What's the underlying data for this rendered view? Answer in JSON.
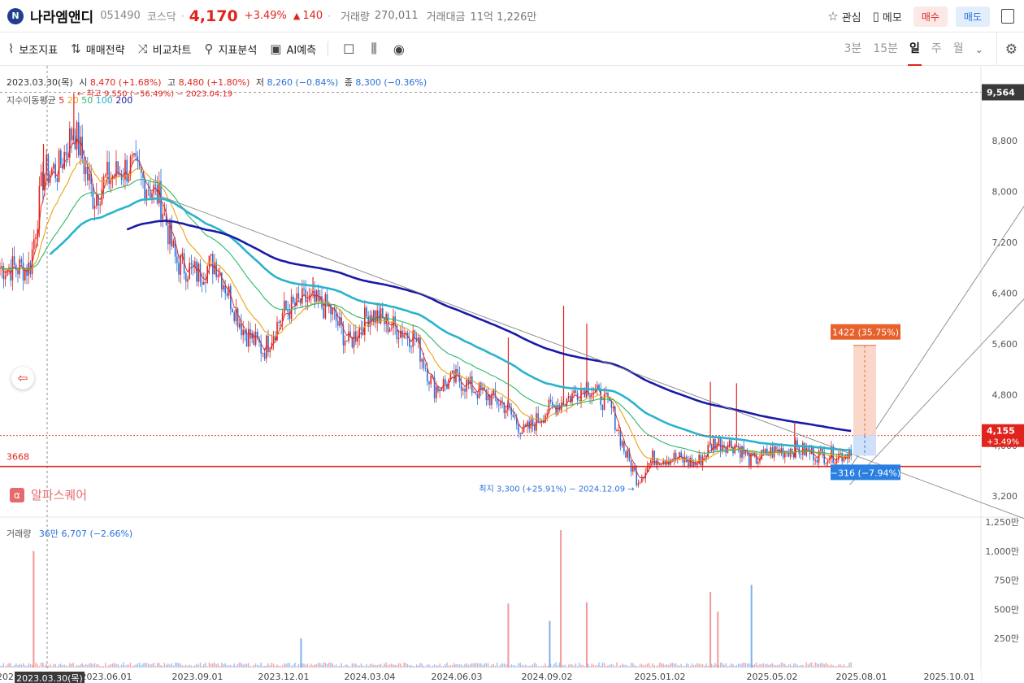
{
  "header": {
    "logo_text": "N",
    "name": "나라엠앤디",
    "code": "051490",
    "market": "코스닥",
    "dot": "·",
    "price": "4,170",
    "change_pct": "+3.49%",
    "change_arrow": "▲",
    "change_abs": "140",
    "volume_label": "거래량",
    "volume_value": "270,011",
    "amount_label": "거래대금",
    "amount_value": "11억 1,226만",
    "watch_label": "관심",
    "memo_label": "메모",
    "buy_label": "매수",
    "sell_label": "매도"
  },
  "toolbar": {
    "indicators": "보조지표",
    "strategy": "매매전략",
    "compare": "비교차트",
    "analysis": "지표분석",
    "ai": "AI예측",
    "periods": [
      "3분",
      "15분",
      "일",
      "주",
      "월"
    ],
    "active_period": "일"
  },
  "legend": {
    "date": "2023.03.30(목)",
    "open_label": "시",
    "open": "8,470 (+1.68%)",
    "high_label": "고",
    "high": "8,480 (+1.80%)",
    "low_label": "저",
    "low": "8,260 (−0.84%)",
    "close_label": "종",
    "close": "8,300 (−0.36%)",
    "ma_label": "지수이동평균",
    "ma_periods": [
      "5",
      "20",
      "50",
      "100",
      "200"
    ],
    "volume_label": "거래량",
    "volume_value": "36만 6,707 (−2.66%)"
  },
  "alpha_square": {
    "icon": "α",
    "text": "알파스퀘어"
  },
  "colors": {
    "up": "#e0241d",
    "down": "#2a6fdb",
    "ma5": "#e0241d",
    "ma20": "#e8a317",
    "ma50": "#2db86b",
    "ma100": "#29b3cc",
    "ma200": "#1a1aa8",
    "support": "#e0241d"
  },
  "chart_data": {
    "type": "candlestick",
    "price_axis": {
      "ticks": [
        3200,
        4000,
        4800,
        5600,
        6400,
        7200,
        8000,
        8800
      ],
      "tick_labels": [
        "3,200",
        "4,000",
        "4,800",
        "5,600",
        "6,400",
        "7,200",
        "8,000",
        "8,800"
      ],
      "range": [
        2870,
        9980
      ]
    },
    "volume_axis": {
      "ticks": [
        250,
        500,
        750,
        1000,
        1250
      ],
      "tick_labels": [
        "250만",
        "500만",
        "750만",
        "1,000만",
        "1,250만"
      ],
      "unit": "만"
    },
    "date_axis": {
      "labels": [
        "2023.06.01",
        "2023.09.01",
        "2023.12.01",
        "2024.03.04",
        "2024.06.03",
        "2024.09.02",
        "2025.01.02",
        "2025.05.02",
        "2025.08.01",
        "2025.10.01"
      ],
      "left_cut_label": "202"
    },
    "highlight_date": "2023.03.30(목)",
    "current_price": {
      "value": 4155,
      "label": "4,155",
      "pct": "+3.49%"
    },
    "crosshair_price": {
      "value": 9564,
      "label": "9,564"
    },
    "max_marker": {
      "text": "최고 9,550 (−56.49%) − 2023.04.19",
      "value": 9550,
      "date": "2023.04.19"
    },
    "min_marker": {
      "text": "최지 3,300 (+25.91%) − 2024.12.09",
      "value": 3300,
      "date": "2024.12.09"
    },
    "support_line": {
      "value": 3668,
      "label": "3668"
    },
    "target_box": {
      "label": "1422 (35.75%)",
      "amount": 1422,
      "pct": 35.75
    },
    "stop_box": {
      "label": "−316 (−7.94%)",
      "amount": -316,
      "pct": -7.94
    },
    "anchors": [
      [
        "2023.02.20",
        6800
      ],
      [
        "2023.03.10",
        8300
      ],
      [
        "2023.03.30",
        8350
      ],
      [
        "2023.04.19",
        9000
      ],
      [
        "2023.05.15",
        7900
      ],
      [
        "2023.06.01",
        8200
      ],
      [
        "2023.06.25",
        8400
      ],
      [
        "2023.07.25",
        7900
      ],
      [
        "2023.08.10",
        6900
      ],
      [
        "2023.09.01",
        6700
      ],
      [
        "2023.09.20",
        6900
      ],
      [
        "2023.10.20",
        5800
      ],
      [
        "2023.11.10",
        5500
      ],
      [
        "2023.12.01",
        6100
      ],
      [
        "2023.12.25",
        6300
      ],
      [
        "2024.01.20",
        6150
      ],
      [
        "2024.02.10",
        5600
      ],
      [
        "2024.03.04",
        6100
      ],
      [
        "2024.03.25",
        5900
      ],
      [
        "2024.04.20",
        5700
      ],
      [
        "2024.05.10",
        4900
      ],
      [
        "2024.06.03",
        5050
      ],
      [
        "2024.06.25",
        4850
      ],
      [
        "2024.07.20",
        4650
      ],
      [
        "2024.08.10",
        4200
      ],
      [
        "2024.09.02",
        4550
      ],
      [
        "2024.09.20",
        4700
      ],
      [
        "2024.10.15",
        4950
      ],
      [
        "2024.11.10",
        4600
      ],
      [
        "2024.11.25",
        3900
      ],
      [
        "2024.12.09",
        3450
      ],
      [
        "2024.12.25",
        3800
      ],
      [
        "2025.01.20",
        3800
      ],
      [
        "2025.02.10",
        3700
      ],
      [
        "2025.03.01",
        4050
      ],
      [
        "2025.03.25",
        4000
      ],
      [
        "2025.04.10",
        3750
      ],
      [
        "2025.05.02",
        3900
      ],
      [
        "2025.05.25",
        3950
      ],
      [
        "2025.06.20",
        3850
      ],
      [
        "2025.07.15",
        3850
      ],
      [
        "2025.08.01",
        4170
      ]
    ],
    "spikes": [
      [
        "2023.04.19",
        9550
      ],
      [
        "2023.03.10",
        8750
      ],
      [
        "2024.01.02",
        6650
      ],
      [
        "2024.07.25",
        5700
      ],
      [
        "2024.09.20",
        6200
      ],
      [
        "2024.10.15",
        5920
      ],
      [
        "2025.02.25",
        5000
      ],
      [
        "2025.03.25",
        4980
      ],
      [
        "2025.05.25",
        4350
      ]
    ],
    "volume_spikes": [
      [
        "2023.02.25",
        1000
      ],
      [
        "2023.12.20",
        250
      ],
      [
        "2024.07.25",
        550
      ],
      [
        "2024.09.17",
        1180
      ],
      [
        "2024.09.05",
        400
      ],
      [
        "2024.10.15",
        560
      ],
      [
        "2025.02.25",
        650
      ],
      [
        "2025.04.10",
        710
      ],
      [
        "2025.03.05",
        480
      ]
    ],
    "trend_lines": [
      {
        "from": [
          "2023.07.20",
          7960
        ],
        "to": [
          "2025.11.30",
          2780
        ]
      },
      {
        "from": [
          "2025.07.20",
          3640
        ],
        "to": [
          "2025.11.30",
          8040
        ]
      },
      {
        "from": [
          "2025.07.20",
          3380
        ],
        "to": [
          "2025.11.30",
          6500
        ]
      }
    ]
  }
}
